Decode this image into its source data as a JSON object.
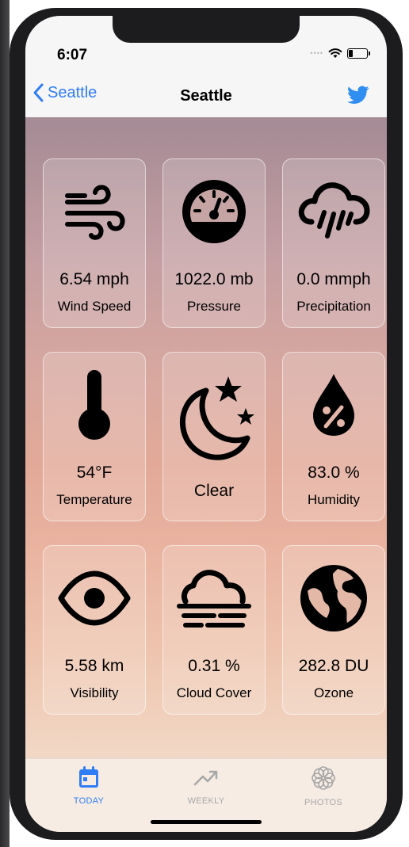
{
  "status_bar": {
    "time": "6:07"
  },
  "nav": {
    "back_label": "Seattle",
    "title": "Seattle"
  },
  "cards": [
    {
      "icon": "wind-icon",
      "value": "6.54 mph",
      "label": "Wind Speed"
    },
    {
      "icon": "gauge-icon",
      "value": "1022.0 mb",
      "label": "Pressure"
    },
    {
      "icon": "rain-cloud-icon",
      "value": "0.0 mmph",
      "label": "Precipitation"
    },
    {
      "icon": "thermometer-icon",
      "value": "54°F",
      "label": "Temperature"
    },
    {
      "icon": "moon-stars-icon",
      "value": "Clear",
      "label": ""
    },
    {
      "icon": "humidity-drop-icon",
      "value": "83.0 %",
      "label": "Humidity"
    },
    {
      "icon": "eye-icon",
      "value": "5.58 km",
      "label": "Visibility"
    },
    {
      "icon": "fog-cloud-icon",
      "value": "0.31 %",
      "label": "Cloud Cover"
    },
    {
      "icon": "globe-icon",
      "value": "282.8 DU",
      "label": "Ozone"
    }
  ],
  "tabbar": {
    "tabs": [
      {
        "label": "TODAY",
        "icon": "calendar-icon",
        "active": true
      },
      {
        "label": "WEEKLY",
        "icon": "trend-icon",
        "active": false
      },
      {
        "label": "PHOTOS",
        "icon": "flower-icon",
        "active": false
      }
    ]
  },
  "colors": {
    "accent": "#2f7df6",
    "tab_inactive": "#a7a7a7",
    "twitter": "#2f8ef0"
  }
}
